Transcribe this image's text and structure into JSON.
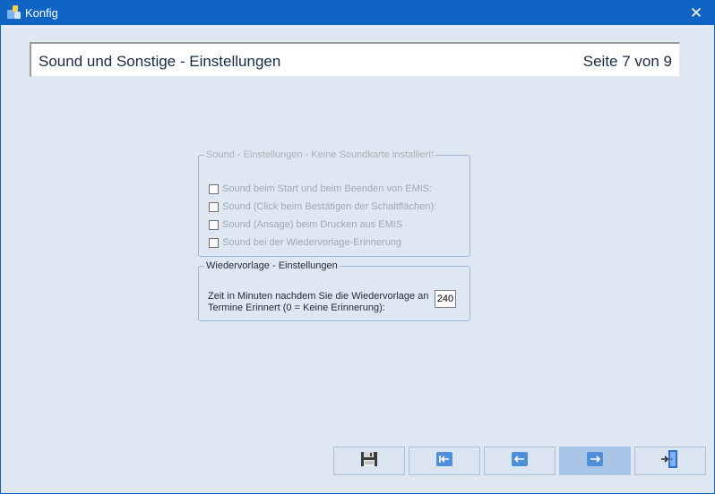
{
  "window": {
    "title": "Konfig",
    "close_glyph": "✕",
    "titlebar_color": "#0f64c4",
    "background_color": "#dfe8f2"
  },
  "header": {
    "title": "Sound und Sonstige - Einstellungen",
    "page": "Seite 7 von 9"
  },
  "sound_group": {
    "legend": "Sound - Einstellungen  -  Keine Soundkarte installiert!",
    "enabled": false,
    "options": [
      {
        "label": "Sound beim Start und beim Beenden von EMIS:",
        "checked": false
      },
      {
        "label": "Sound (Click beim Bestätigen der Schaltflächen):",
        "checked": false
      },
      {
        "label": "Sound (Ansage) beim Drucken aus EMIS",
        "checked": false
      },
      {
        "label": "Sound bei der Wiedervorlage-Erinnerung",
        "checked": false
      }
    ]
  },
  "wiedervorlage_group": {
    "legend": "Wiedervorlage - Einstellungen",
    "label": "Zeit in Minuten nachdem Sie die Wiedervorlage an Termine Erinnert (0 = Keine Erinnerung):",
    "minutes_value": "240"
  },
  "nav_buttons": [
    {
      "icon": "save-icon",
      "state": "normal"
    },
    {
      "icon": "first-page-icon",
      "state": "normal"
    },
    {
      "icon": "previous-page-icon",
      "state": "normal"
    },
    {
      "icon": "next-page-icon",
      "state": "active"
    },
    {
      "icon": "exit-door-icon",
      "state": "normal"
    }
  ]
}
